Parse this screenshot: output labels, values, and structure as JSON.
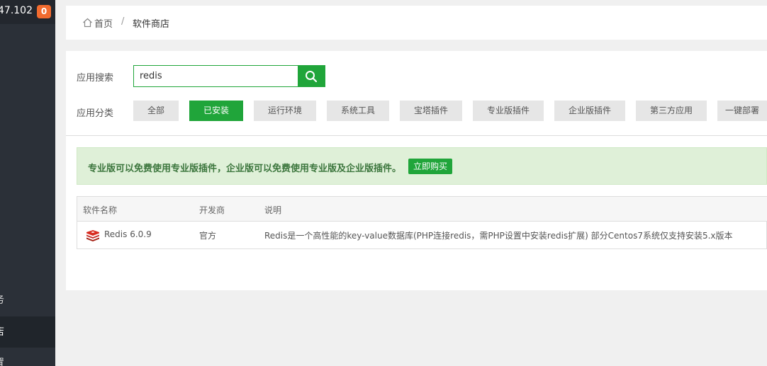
{
  "sidebar": {
    "ip": "47.102",
    "badge": "0",
    "items": [
      {
        "label": "务"
      },
      {
        "label": "店"
      },
      {
        "label": "置"
      }
    ]
  },
  "breadcrumb": {
    "home": "首页",
    "separator": "/",
    "current": "软件商店"
  },
  "search": {
    "label": "应用搜索",
    "value": "redis"
  },
  "categories": {
    "label": "应用分类",
    "items": [
      "全部",
      "已安装",
      "运行环境",
      "系统工具",
      "宝塔插件",
      "专业版插件",
      "企业版插件",
      "第三方应用",
      "一键部署"
    ],
    "active": "已安装"
  },
  "notice": {
    "text": "专业版可以免费使用专业版插件，企业版可以免费使用专业版及企业版插件。",
    "button": "立即购买"
  },
  "table": {
    "headers": [
      "软件名称",
      "开发商",
      "说明"
    ],
    "rows": [
      {
        "name": "Redis 6.0.9",
        "developer": "官方",
        "description": "Redis是一个高性能的key-value数据库(PHP连接redis，需PHP设置中安装redis扩展) 部分Centos7系统仅支持安装5.x版本"
      }
    ]
  },
  "colors": {
    "accent": "#20a53a",
    "sidebar": "#2b3038",
    "badge": "#f26b2f",
    "notice_bg": "#dff0d8",
    "notice_text": "#3c763d"
  },
  "icons": [
    "home-icon",
    "search-icon",
    "redis-icon"
  ]
}
